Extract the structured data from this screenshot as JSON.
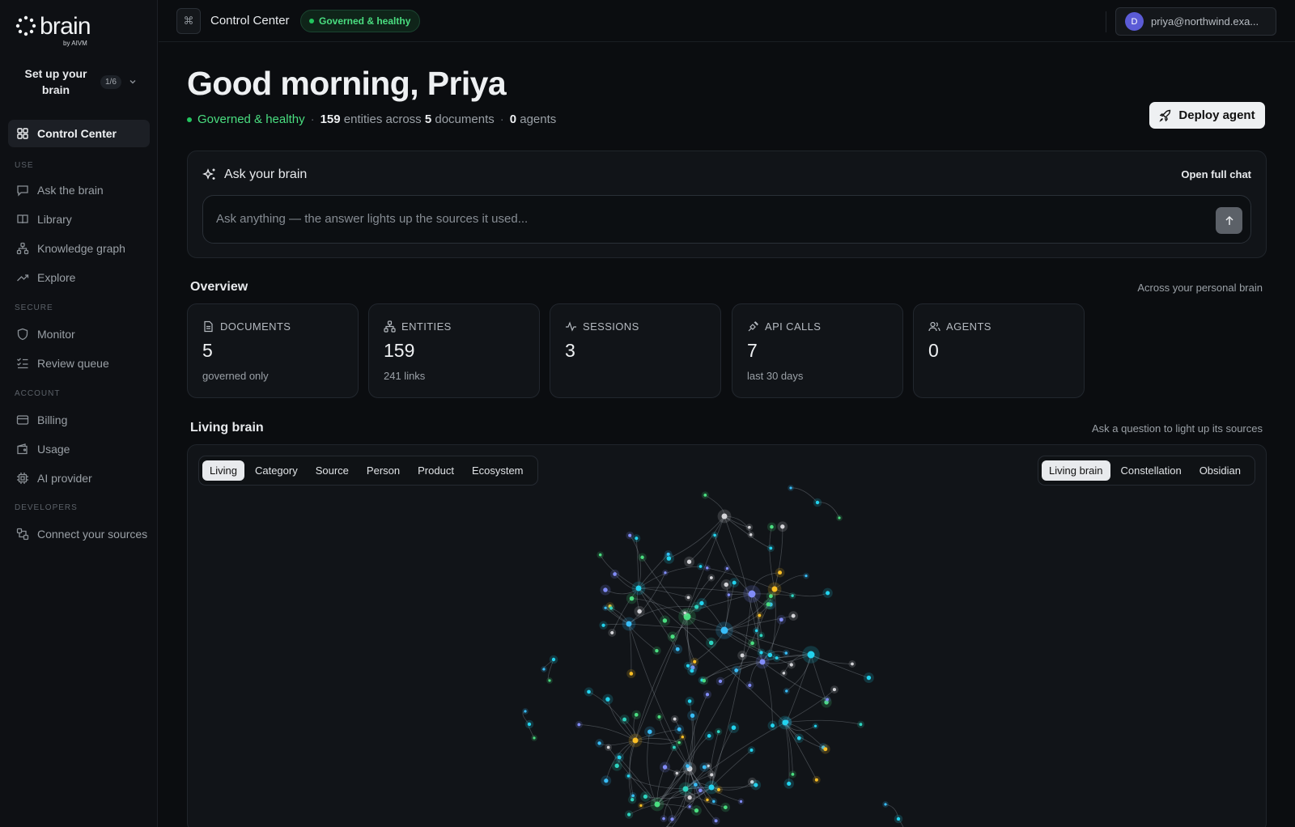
{
  "brand": {
    "name": "brain",
    "byline": "by AIVM"
  },
  "setup": {
    "label": "Set up your brain",
    "progress": "1/6"
  },
  "sidebar": {
    "active": {
      "label": "Control Center",
      "icon": "grid-icon"
    },
    "sections": [
      {
        "title": "USE",
        "items": [
          {
            "label": "Ask the brain",
            "icon": "chat-icon"
          },
          {
            "label": "Library",
            "icon": "book-icon"
          },
          {
            "label": "Knowledge graph",
            "icon": "graph-icon"
          },
          {
            "label": "Explore",
            "icon": "trend-icon"
          }
        ]
      },
      {
        "title": "SECURE",
        "items": [
          {
            "label": "Monitor",
            "icon": "shield-icon"
          },
          {
            "label": "Review queue",
            "icon": "checklist-icon"
          }
        ]
      },
      {
        "title": "ACCOUNT",
        "items": [
          {
            "label": "Billing",
            "icon": "card-icon"
          },
          {
            "label": "Usage",
            "icon": "wallet-icon"
          },
          {
            "label": "AI provider",
            "icon": "chip-icon"
          }
        ]
      },
      {
        "title": "DEVELOPERS",
        "items": [
          {
            "label": "Connect your sources",
            "icon": "plug-icon"
          }
        ]
      }
    ]
  },
  "topbar": {
    "command_icon": "⌘",
    "title": "Control Center",
    "status": "Governed & healthy",
    "user": {
      "initial": "D",
      "email": "priya@northwind.exa..."
    }
  },
  "header": {
    "greeting": "Good morning, Priya",
    "status": "Governed & healthy",
    "entities_count": "159",
    "entities_text": "entities across",
    "documents_count": "5",
    "documents_text": "documents",
    "agents_count": "0",
    "agents_text": "agents",
    "deploy_label": "Deploy agent"
  },
  "ask": {
    "title": "Ask your brain",
    "open_chat": "Open full chat",
    "placeholder": "Ask anything — the answer lights up the sources it used..."
  },
  "overview": {
    "title": "Overview",
    "aside": "Across your personal brain",
    "stats": [
      {
        "label": "DOCUMENTS",
        "value": "5",
        "note": "governed only",
        "icon": "document-icon"
      },
      {
        "label": "ENTITIES",
        "value": "159",
        "note": "241 links",
        "icon": "entity-icon"
      },
      {
        "label": "SESSIONS",
        "value": "3",
        "note": "",
        "icon": "pulse-icon"
      },
      {
        "label": "API CALLS",
        "value": "7",
        "note": "last 30 days",
        "icon": "plug-icon"
      },
      {
        "label": "AGENTS",
        "value": "0",
        "note": "",
        "icon": "users-icon"
      }
    ]
  },
  "living_brain": {
    "title": "Living brain",
    "aside": "Ask a question to light up its sources",
    "filters": [
      "Living",
      "Category",
      "Source",
      "Person",
      "Product",
      "Ecosystem"
    ],
    "selected_filter": "Living",
    "views": [
      "Living brain",
      "Constellation",
      "Obsidian"
    ],
    "selected_view": "Living brain"
  },
  "colors": {
    "accent_green": "#4ade80",
    "status_dot": "#22c55e",
    "background": "#0b0d10",
    "card": "#111418",
    "avatar": "#5b5bd6",
    "graph_nodes": [
      "#22d3ee",
      "#38bdf8",
      "#818cf8",
      "#4ade80",
      "#fbbf24",
      "#d4d4d8",
      "#2dd4bf"
    ]
  }
}
